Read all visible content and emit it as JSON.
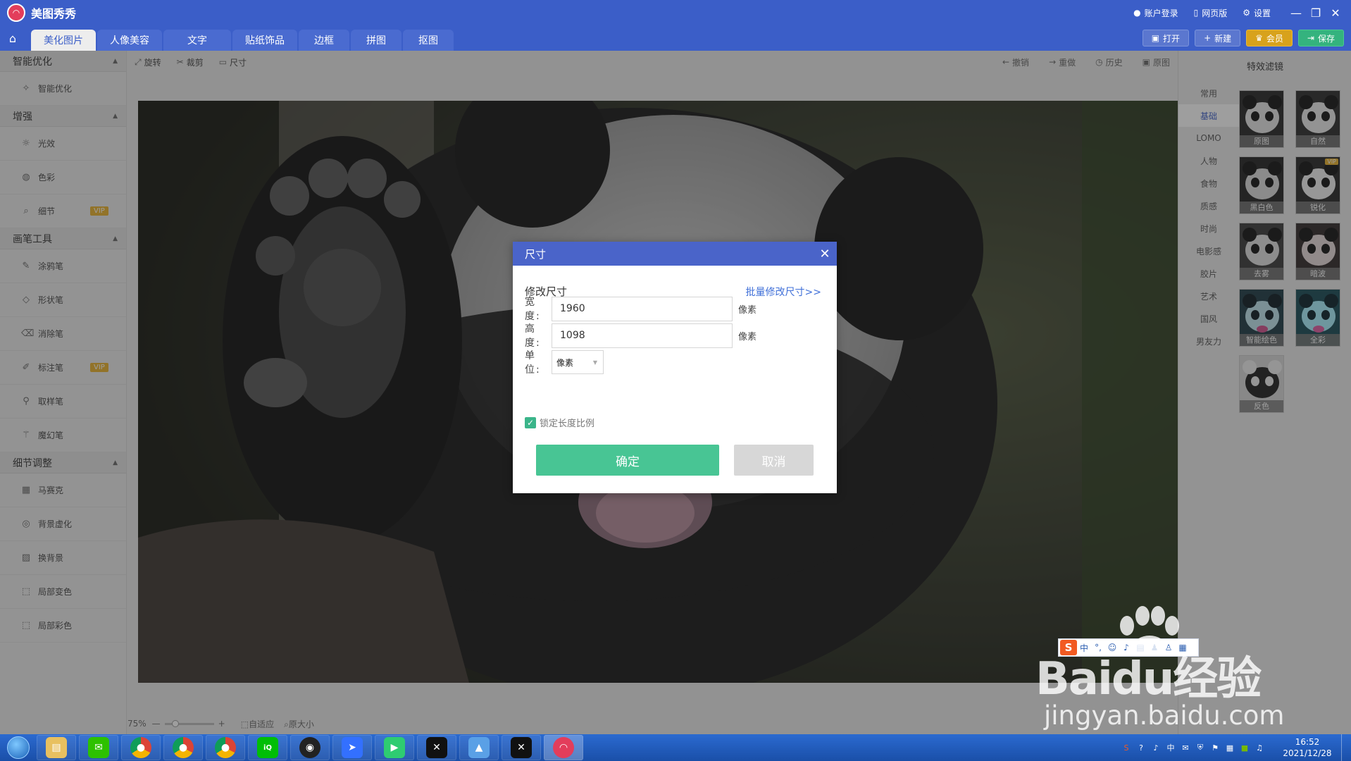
{
  "app": {
    "title": "美图秀秀",
    "logo_icon": "meitu-logo-icon"
  },
  "titlebar": {
    "login": "账户登录",
    "web": "网页版",
    "settings": "设置"
  },
  "tabs": [
    {
      "label": "美化图片",
      "active": true
    },
    {
      "label": "人像美容"
    },
    {
      "label": "文字"
    },
    {
      "label": "贴纸饰品"
    },
    {
      "label": "边框"
    },
    {
      "label": "拼图"
    },
    {
      "label": "抠图"
    }
  ],
  "actions": {
    "open": "打开",
    "new": "新建",
    "vip": "会员",
    "save": "保存"
  },
  "toolbar": {
    "rotate": "旋转",
    "crop": "裁剪",
    "size": "尺寸",
    "undo": "撤销",
    "redo": "重做",
    "history": "历史",
    "original": "原图"
  },
  "sidebar": {
    "sections": [
      {
        "title": "智能优化",
        "items": [
          {
            "label": "智能优化",
            "icon": "magic-icon"
          }
        ]
      },
      {
        "title": "增强",
        "items": [
          {
            "label": "光效",
            "icon": "sun-icon"
          },
          {
            "label": "色彩",
            "icon": "palette-icon"
          },
          {
            "label": "细节",
            "icon": "magnifier-icon",
            "vip": "VIP"
          }
        ]
      },
      {
        "title": "画笔工具",
        "items": [
          {
            "label": "涂鸦笔",
            "icon": "brush-icon"
          },
          {
            "label": "形状笔",
            "icon": "shape-icon"
          },
          {
            "label": "消除笔",
            "icon": "eraser-icon"
          },
          {
            "label": "标注笔",
            "icon": "pen-icon",
            "vip": "VIP"
          },
          {
            "label": "取样笔",
            "icon": "dropper-icon"
          },
          {
            "label": "魔幻笔",
            "icon": "wand-icon"
          }
        ]
      },
      {
        "title": "细节调整",
        "items": [
          {
            "label": "马赛克",
            "icon": "mosaic-icon"
          },
          {
            "label": "背景虚化",
            "icon": "blur-icon"
          },
          {
            "label": "换背景",
            "icon": "background-icon"
          },
          {
            "label": "局部变色",
            "icon": "recolor-icon"
          },
          {
            "label": "局部彩色",
            "icon": "color-splash-icon"
          }
        ]
      }
    ]
  },
  "status": {
    "zoom": "75%",
    "fit": "自适应",
    "actual": "原大小"
  },
  "rightpanel": {
    "title": "特效滤镜",
    "categories": [
      "常用",
      "基础",
      "LOMO",
      "人物",
      "食物",
      "质感",
      "时尚",
      "电影感",
      "胶片",
      "艺术",
      "国风",
      "男友力"
    ],
    "active_category": "基础",
    "filters": [
      {
        "label": "原图"
      },
      {
        "label": "自然"
      },
      {
        "label": "黑白色"
      },
      {
        "label": "锐化",
        "vip": "VIP"
      },
      {
        "label": "去雾"
      },
      {
        "label": "暗波"
      },
      {
        "label": "智能绘色"
      },
      {
        "label": "全彩"
      },
      {
        "label": "反色"
      }
    ]
  },
  "dialog": {
    "title": "尺寸",
    "subtitle": "修改尺寸",
    "batch_link": "批量修改尺寸>>",
    "width_label": "宽度:",
    "width_value": "1960",
    "height_label": "高度:",
    "height_value": "1098",
    "unit_word": "像素",
    "unit_label": "单位:",
    "unit_select": "像素",
    "lock_label": "锁定长度比例",
    "lock_checked": true,
    "ok": "确定",
    "cancel": "取消"
  },
  "ime": {
    "brand": "S",
    "lang": "中"
  },
  "watermark": {
    "line1": "Baidu经验",
    "line2": "jingyan.baidu.com"
  },
  "taskbar": {
    "time": "16:52",
    "date": "2021/12/28",
    "apps": [
      "file-explorer-icon",
      "wechat-icon",
      "chrome-icon",
      "chrome-icon",
      "chrome-icon",
      "iqiyi-icon",
      "obs-icon",
      "feishu-icon",
      "video-player-icon",
      "capcut-icon",
      "photos-icon",
      "capcut-icon",
      "meitu-icon"
    ]
  },
  "colors": {
    "brand": "#3b5ec8",
    "ok": "#48c594",
    "link": "#3f6fd8"
  }
}
